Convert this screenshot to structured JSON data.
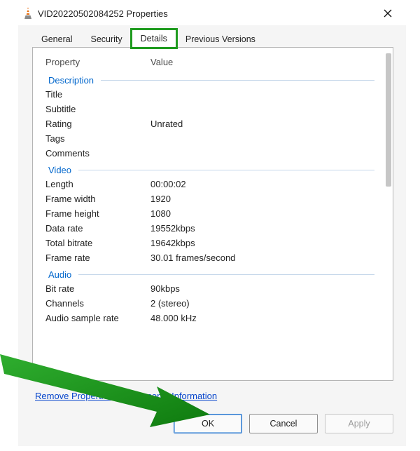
{
  "window": {
    "title": "VID20220502084252 Properties"
  },
  "tabs": [
    {
      "label": "General"
    },
    {
      "label": "Security"
    },
    {
      "label": "Details"
    },
    {
      "label": "Previous Versions"
    }
  ],
  "columns": {
    "property": "Property",
    "value": "Value"
  },
  "sections": [
    {
      "name": "Description",
      "rows": [
        {
          "prop": "Title",
          "val": ""
        },
        {
          "prop": "Subtitle",
          "val": ""
        },
        {
          "prop": "Rating",
          "val": "Unrated"
        },
        {
          "prop": "Tags",
          "val": ""
        },
        {
          "prop": "Comments",
          "val": ""
        }
      ]
    },
    {
      "name": "Video",
      "rows": [
        {
          "prop": "Length",
          "val": "00:00:02"
        },
        {
          "prop": "Frame width",
          "val": "1920"
        },
        {
          "prop": "Frame height",
          "val": "1080"
        },
        {
          "prop": "Data rate",
          "val": "19552kbps"
        },
        {
          "prop": "Total bitrate",
          "val": "19642kbps"
        },
        {
          "prop": "Frame rate",
          "val": "30.01 frames/second"
        }
      ]
    },
    {
      "name": "Audio",
      "rows": [
        {
          "prop": "Bit rate",
          "val": "90kbps"
        },
        {
          "prop": "Channels",
          "val": "2 (stereo)"
        },
        {
          "prop": "Audio sample rate",
          "val": "48.000 kHz"
        }
      ]
    }
  ],
  "link": "Remove Properties and Personal Information",
  "buttons": {
    "ok": "OK",
    "cancel": "Cancel",
    "apply": "Apply"
  }
}
